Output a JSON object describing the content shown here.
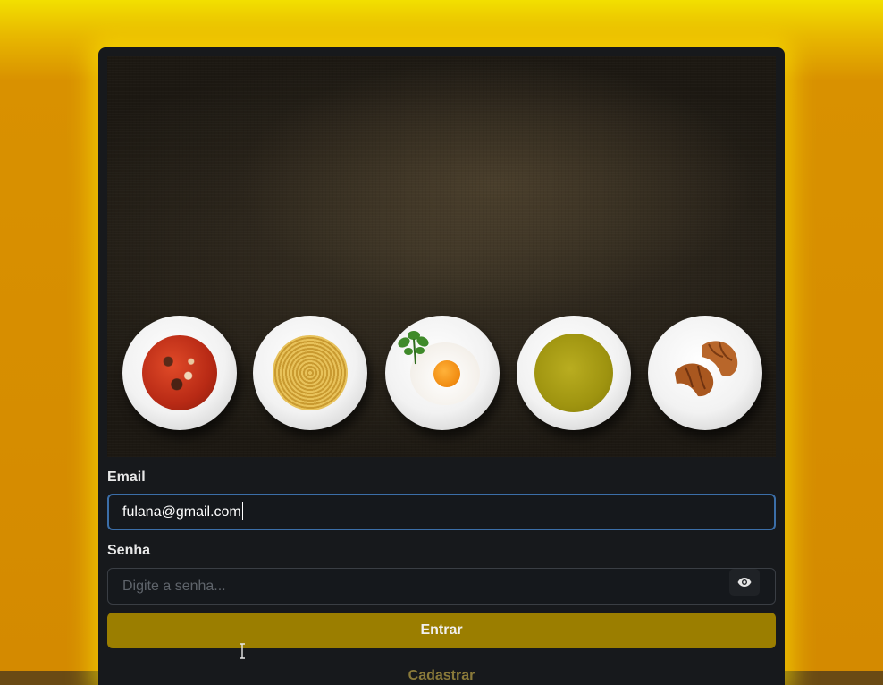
{
  "hero": {
    "dishes": [
      "tomato-soup",
      "spaghetti",
      "fried-egg",
      "pea-soup",
      "croissants"
    ]
  },
  "form": {
    "email_label": "Email",
    "email_value": "fulana@gmail.com",
    "password_label": "Senha",
    "password_placeholder": "Digite a senha...",
    "toggle_icon": "eye-icon",
    "submit_label": "Entrar",
    "register_label": "Cadastrar"
  },
  "colors": {
    "page_background": "#d48a00",
    "card_background": "#17191c",
    "accent_glow": "#f2e000",
    "submit_button": "#9b7e00",
    "input_focus_border": "#3b6ea8"
  }
}
